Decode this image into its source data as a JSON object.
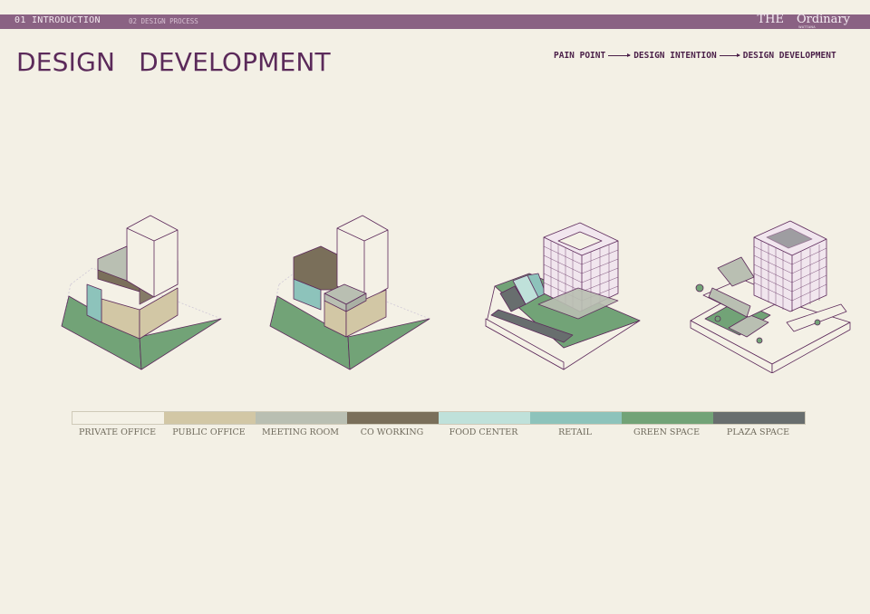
{
  "header": {
    "nav_primary": "01 INTRODUCTION",
    "nav_secondary": "02 DESIGN PROCESS",
    "brand_the": "THE",
    "brand_name": "Ordinary",
    "brand_sub": "WATTANA"
  },
  "title": {
    "word1": "DESIGN",
    "word2": "DEVELOPMENT"
  },
  "process_flow": {
    "step1": "PAIN POINT",
    "step2": "DESIGN INTENTION",
    "step3": "DESIGN DEVELOPMENT"
  },
  "legend": {
    "items": [
      {
        "label": "PRIVATE OFFICE",
        "color": "#f4f1e6"
      },
      {
        "label": "PUBLIC OFFICE",
        "color": "#d2c7a5"
      },
      {
        "label": "MEETING ROOM",
        "color": "#b9bfb2"
      },
      {
        "label": "CO WORKING",
        "color": "#7a6f5a"
      },
      {
        "label": "FOOD CENTER",
        "color": "#bfe1da"
      },
      {
        "label": "RETAIL",
        "color": "#8dc3bb"
      },
      {
        "label": "GREEN SPACE",
        "color": "#72a377"
      },
      {
        "label": "PLAZA SPACE",
        "color": "#686e6e"
      }
    ]
  },
  "colors": {
    "header_bar": "#8a6283",
    "title": "#5b2a5a",
    "outline": "#5d2a5b",
    "background": "#f3f0e5"
  }
}
